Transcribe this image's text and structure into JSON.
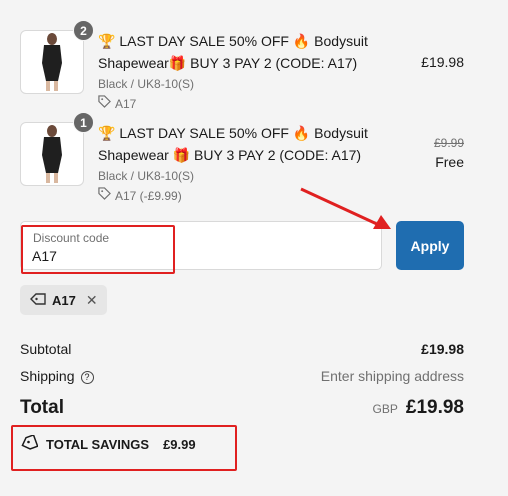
{
  "items": [
    {
      "quantity": "2",
      "title": "🏆 LAST DAY SALE 50% OFF 🔥 Bodysuit Shapewear🎁 BUY 3 PAY 2 (CODE: A17)",
      "variant": "Black / UK8-10(S)",
      "discount": "A17",
      "price": "£19.98"
    },
    {
      "quantity": "1",
      "title": "🏆 LAST DAY SALE 50% OFF 🔥 Bodysuit Shapewear 🎁 BUY 3 PAY 2 (CODE: A17)",
      "variant": "Black / UK8-10(S)",
      "discount": "A17 (-£9.99)",
      "original_price": "£9.99",
      "price": "Free"
    }
  ],
  "discount_field": {
    "label": "Discount code",
    "value": "A17"
  },
  "apply_button": "Apply",
  "applied_code": "A17",
  "summary": {
    "subtotal_label": "Subtotal",
    "subtotal_value": "£19.98",
    "shipping_label": "Shipping",
    "shipping_value": "Enter shipping address",
    "total_label": "Total",
    "currency": "GBP",
    "total_value": "£19.98",
    "savings_label": "TOTAL SAVINGS",
    "savings_value": "£9.99"
  },
  "colors": {
    "accent": "#1f6db0",
    "highlight": "#e02020"
  }
}
